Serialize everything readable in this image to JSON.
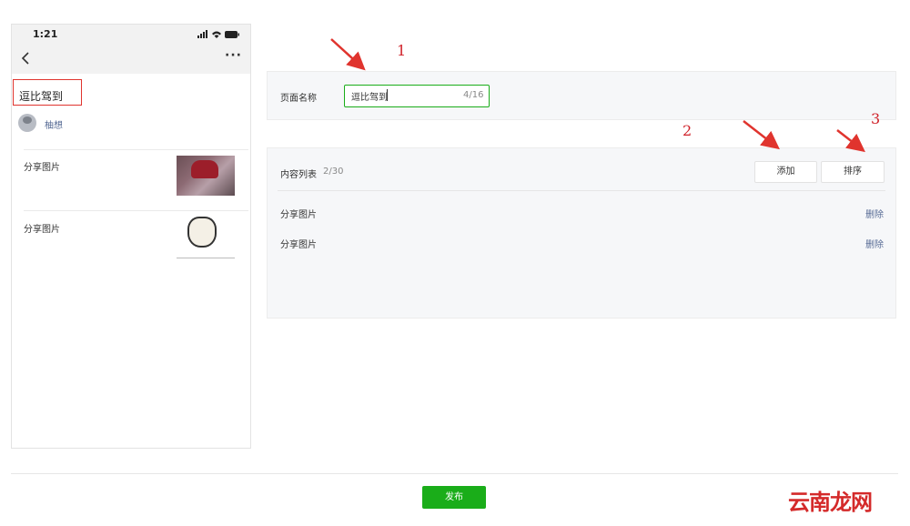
{
  "phone": {
    "time": "1:21",
    "page_title": "逗比驾到",
    "author": "柚想",
    "items": [
      {
        "label": "分享图片"
      },
      {
        "label": "分享图片"
      }
    ]
  },
  "form": {
    "name_label": "页面名称",
    "name_value": "逗比驾到",
    "name_count": "4/16",
    "list_title": "内容列表",
    "list_count": "2/30",
    "add_label": "添加",
    "sort_label": "排序",
    "rows": [
      {
        "label": "分享图片",
        "action": "删除"
      },
      {
        "label": "分享图片",
        "action": "删除"
      }
    ]
  },
  "footer": {
    "publish_label": "发布"
  },
  "annotations": {
    "n1": "1",
    "n2": "2",
    "n3": "3"
  },
  "watermark": "云南龙网",
  "colors": {
    "accent": "#1aad19",
    "annotation": "#e0342e",
    "link": "#576b95"
  }
}
